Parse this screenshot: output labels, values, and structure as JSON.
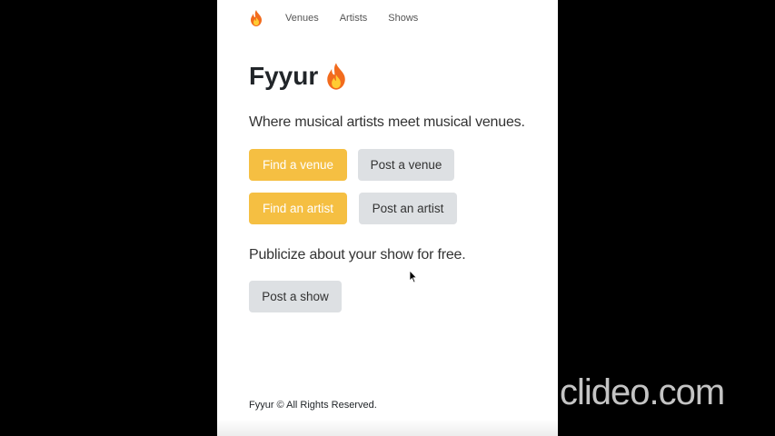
{
  "nav": {
    "brand_icon": "flame-icon",
    "links": [
      "Venues",
      "Artists",
      "Shows"
    ]
  },
  "hero": {
    "title": "Fyyur",
    "title_icon": "flame-icon",
    "tagline": "Where musical artists meet musical venues."
  },
  "actions": {
    "find_venue": "Find a venue",
    "post_venue": "Post a venue",
    "find_artist": "Find an artist",
    "post_artist": "Post an artist"
  },
  "shows": {
    "text": "Publicize about your show for free.",
    "post_show": "Post a show"
  },
  "footer": {
    "text": "Fyyur © All Rights Reserved."
  },
  "overlay": {
    "watermark": "clideo.com"
  },
  "colors": {
    "primary_button": "#f5bf42",
    "secondary_button": "#dde0e3",
    "background_letterbox": "#000000",
    "page_background": "#ffffff"
  }
}
